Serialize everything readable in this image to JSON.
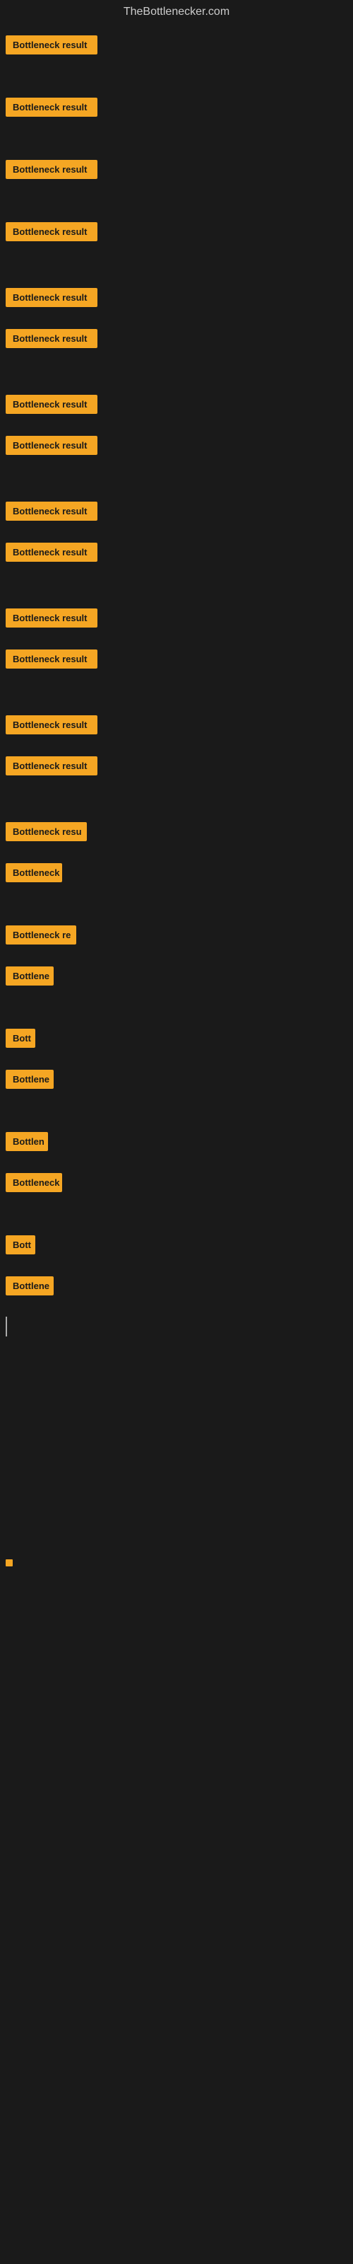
{
  "site": {
    "title": "TheBottlenecker.com"
  },
  "items": [
    {
      "label": "Bottleneck result",
      "width": 130,
      "marginTop": 10
    },
    {
      "label": "Bottleneck result",
      "width": 130,
      "marginTop": 40
    },
    {
      "label": "Bottleneck result",
      "width": 130,
      "marginTop": 40
    },
    {
      "label": "Bottleneck result",
      "width": 130,
      "marginTop": 40
    },
    {
      "label": "Bottleneck result",
      "width": 130,
      "marginTop": 45
    },
    {
      "label": "Bottleneck result",
      "width": 130,
      "marginTop": 10
    },
    {
      "label": "Bottleneck result",
      "width": 130,
      "marginTop": 45
    },
    {
      "label": "Bottleneck result",
      "width": 130,
      "marginTop": 10
    },
    {
      "label": "Bottleneck result",
      "width": 130,
      "marginTop": 45
    },
    {
      "label": "Bottleneck result",
      "width": 130,
      "marginTop": 10
    },
    {
      "label": "Bottleneck result",
      "width": 130,
      "marginTop": 45
    },
    {
      "label": "Bottleneck result",
      "width": 130,
      "marginTop": 10
    },
    {
      "label": "Bottleneck result",
      "width": 130,
      "marginTop": 45
    },
    {
      "label": "Bottleneck result",
      "width": 130,
      "marginTop": 10
    },
    {
      "label": "Bottleneck resu",
      "width": 115,
      "marginTop": 45
    },
    {
      "label": "Bottleneck",
      "width": 80,
      "marginTop": 10
    },
    {
      "label": "Bottleneck re",
      "width": 100,
      "marginTop": 40
    },
    {
      "label": "Bottlene",
      "width": 68,
      "marginTop": 10
    },
    {
      "label": "Bott",
      "width": 42,
      "marginTop": 40
    },
    {
      "label": "Bottlene",
      "width": 68,
      "marginTop": 10
    },
    {
      "label": "Bottlen",
      "width": 60,
      "marginTop": 40
    },
    {
      "label": "Bottleneck",
      "width": 80,
      "marginTop": 10
    },
    {
      "label": "Bott",
      "width": 42,
      "marginTop": 40
    },
    {
      "label": "Bottlene",
      "width": 68,
      "marginTop": 10
    }
  ],
  "cursor": {
    "visible": true
  },
  "footer_dot": {
    "visible": true
  }
}
